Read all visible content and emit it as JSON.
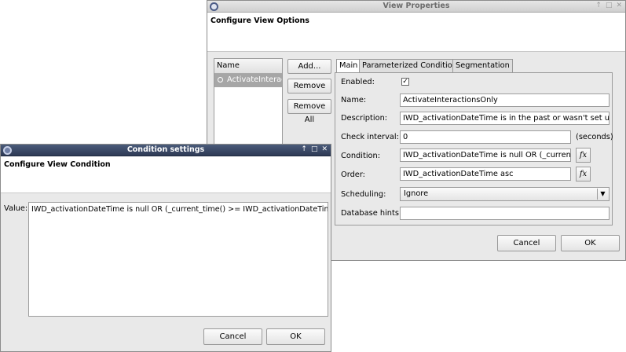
{
  "view_properties": {
    "title": "View Properties",
    "header_title": "Configure View Options",
    "list": {
      "header": "Name",
      "items": [
        "ActivateInteractionsOnly"
      ]
    },
    "buttons": {
      "add": "Add...",
      "remove": "Remove",
      "remove_all": "Remove All"
    },
    "tabs": [
      "Main",
      "Parameterized Conditions",
      "Segmentation"
    ],
    "form": {
      "enabled_label": "Enabled:",
      "enabled_checked": true,
      "name_label": "Name:",
      "name_value": "ActivateInteractionsOnly",
      "description_label": "Description:",
      "description_value": "IWD_activationDateTime is in the past or wasn't set up at all",
      "check_interval_label": "Check interval:",
      "check_interval_value": "0",
      "check_interval_unit": "(seconds)",
      "condition_label": "Condition:",
      "condition_value": "IWD_activationDateTime is null OR (_current_time() >= IWD_activationDateTime)",
      "order_label": "Order:",
      "order_value": "IWD_activationDateTime asc",
      "scheduling_label": "Scheduling:",
      "scheduling_value": "Ignore",
      "database_hints_label": "Database hints:",
      "database_hints_value": "",
      "fx_label": "fx"
    },
    "footer": {
      "cancel": "Cancel",
      "ok": "OK"
    }
  },
  "condition_settings": {
    "title": "Condition settings",
    "header_title": "Configure View Condition",
    "value_label": "Value:",
    "value_text": "IWD_activationDateTime is null OR (_current_time() >= IWD_activationDateTime)",
    "footer": {
      "cancel": "Cancel",
      "ok": "OK"
    }
  },
  "titlebar_buttons": {
    "pin": "↑",
    "maximize": "□",
    "close": "✕"
  }
}
